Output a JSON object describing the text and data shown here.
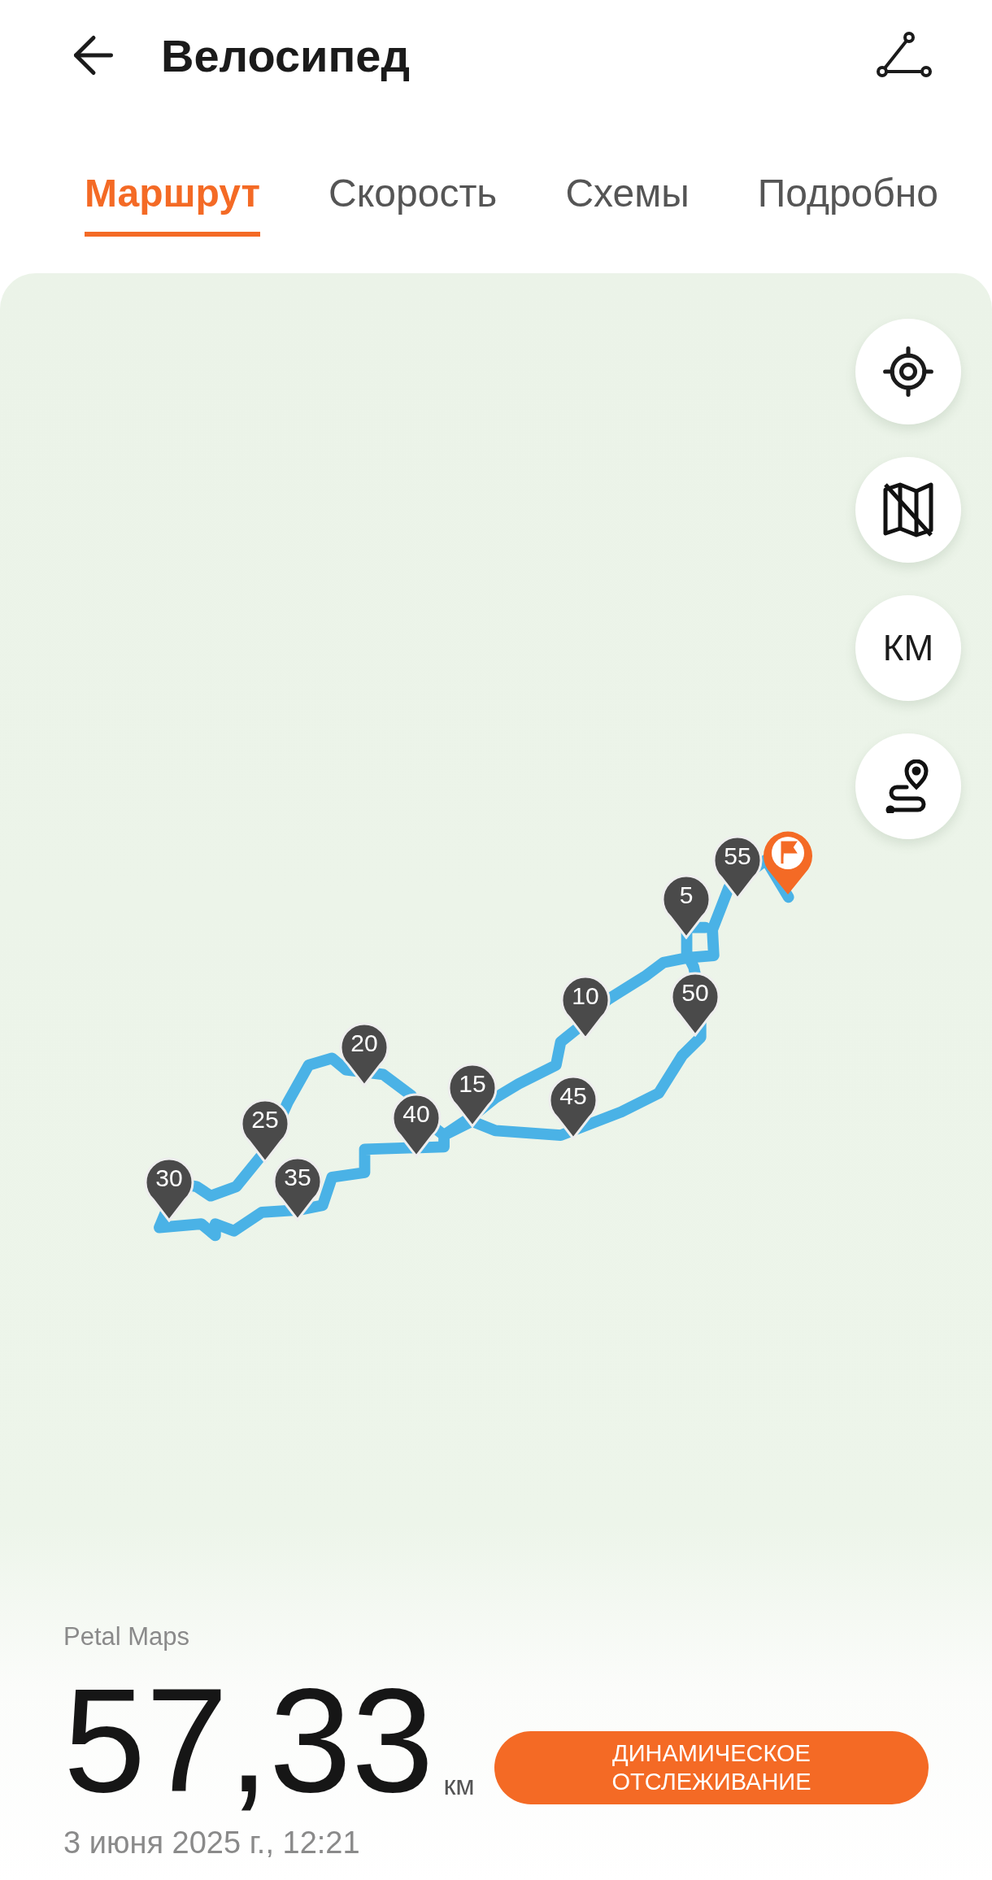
{
  "header": {
    "title": "Велосипед"
  },
  "tabs": [
    {
      "label": "Маршрут",
      "selected": true
    },
    {
      "label": "Скорость",
      "selected": false
    },
    {
      "label": "Схемы",
      "selected": false
    },
    {
      "label": "Подробно",
      "selected": false
    }
  ],
  "map": {
    "controls": [
      {
        "kind": "locate"
      },
      {
        "kind": "map-style"
      },
      {
        "kind": "units",
        "label": "КМ"
      },
      {
        "kind": "route"
      }
    ],
    "markers": [
      {
        "label": "5"
      },
      {
        "label": "10"
      },
      {
        "label": "15"
      },
      {
        "label": "20"
      },
      {
        "label": "25"
      },
      {
        "label": "30"
      },
      {
        "label": "35"
      },
      {
        "label": "40"
      },
      {
        "label": "45"
      },
      {
        "label": "50"
      },
      {
        "label": "55"
      }
    ],
    "source": "Petal Maps"
  },
  "summary": {
    "distance": "57,33",
    "unit": "км",
    "date": "3 июня 2025 г., 12:21",
    "button": "ДИНАМИЧЕСКОЕ ОТСЛЕЖИВАНИЕ"
  }
}
